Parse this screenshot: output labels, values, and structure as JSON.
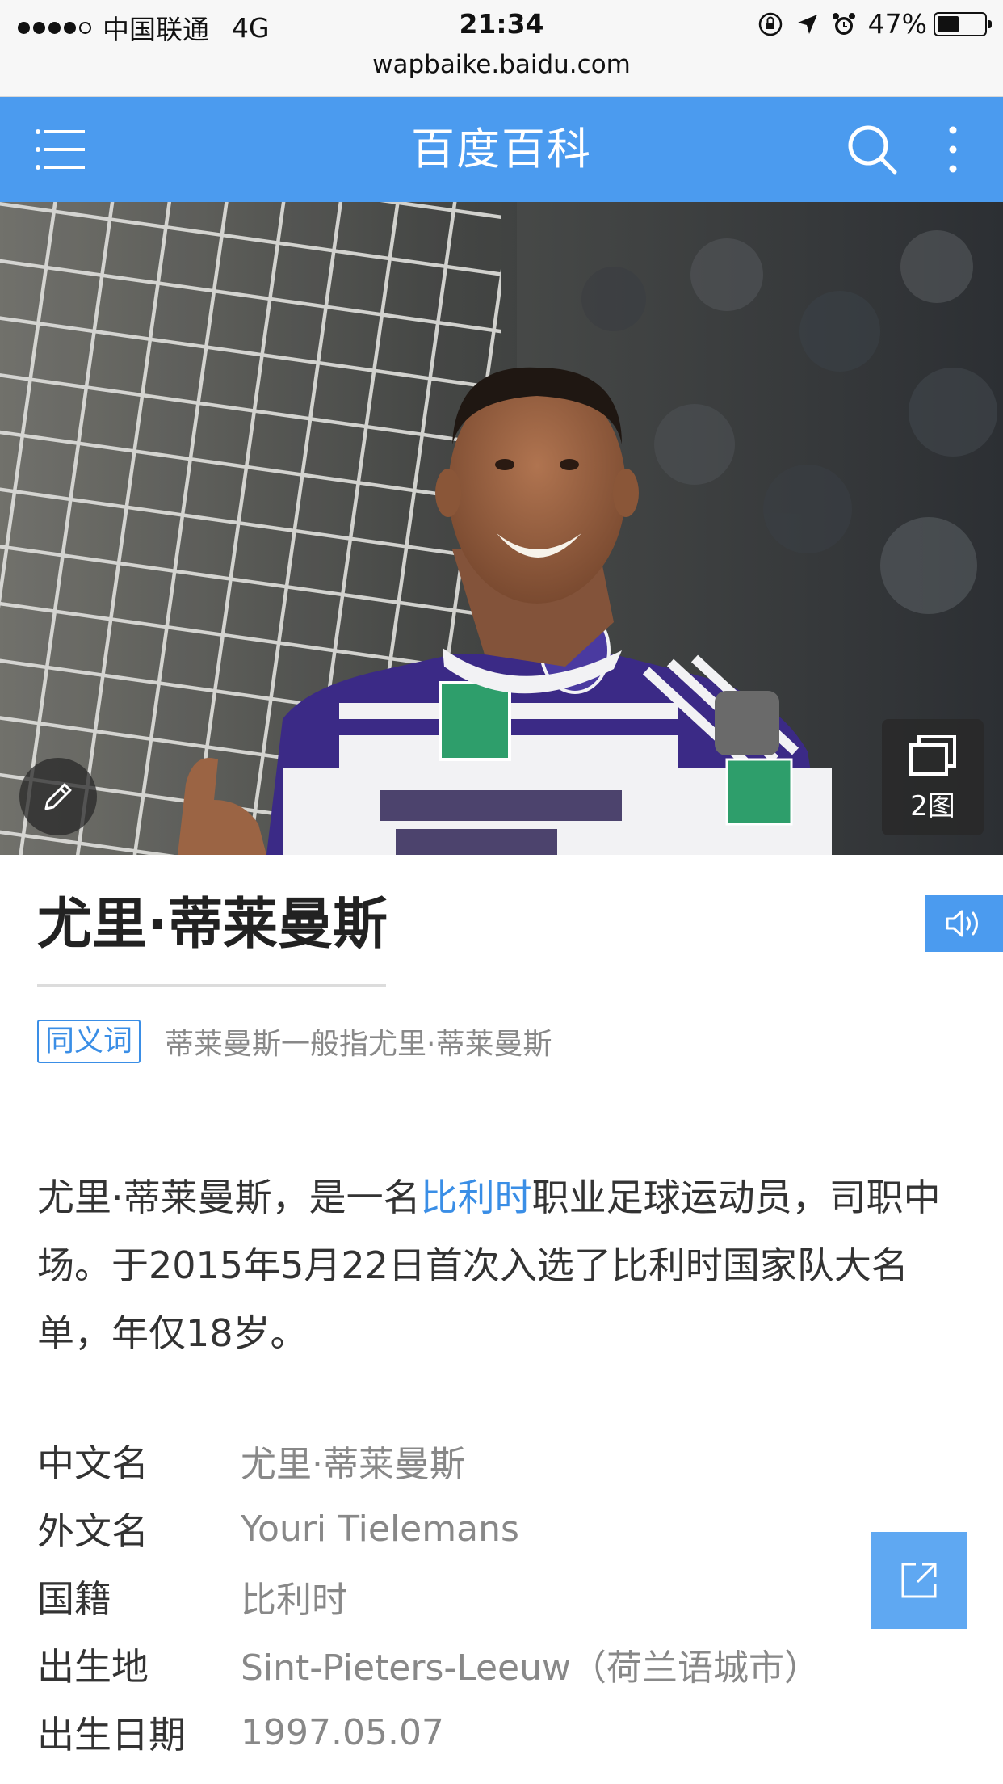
{
  "status_bar": {
    "carrier": "中国联通",
    "network": "4G",
    "time": "21:34",
    "battery": "47%",
    "battery_level": 0.47
  },
  "url": "wapbaike.baidu.com",
  "header": {
    "title": "百度百科",
    "icons": [
      "menu-icon",
      "search-icon",
      "more-vertical-icon"
    ]
  },
  "hero": {
    "gallery_count": "2图",
    "icons": [
      "edit-icon",
      "gallery-icon"
    ]
  },
  "entry": {
    "title": "尤里·蒂莱曼斯",
    "synonym_tag": "同义词",
    "synonym_text": "蒂莱曼斯一般指尤里·蒂莱曼斯",
    "summary_before": "尤里·蒂莱曼斯，是一名",
    "summary_link": "比利时",
    "summary_after": "职业足球运动员，司职中场。于2015年5月22日首次入选了比利时国家队大名单，年仅18岁。"
  },
  "info": [
    {
      "label": "中文名",
      "value": "尤里·蒂莱曼斯"
    },
    {
      "label": "外文名",
      "value": "Youri Tielemans"
    },
    {
      "label": "国籍",
      "value": "比利时"
    },
    {
      "label": "出生地",
      "value": "Sint-Pieters-Leeuw（荷兰语城市）"
    },
    {
      "label": "出生日期",
      "value": "1997.05.07"
    }
  ],
  "colors": {
    "brand_blue": "#4b9bef",
    "link_blue": "#3a8ee6"
  }
}
